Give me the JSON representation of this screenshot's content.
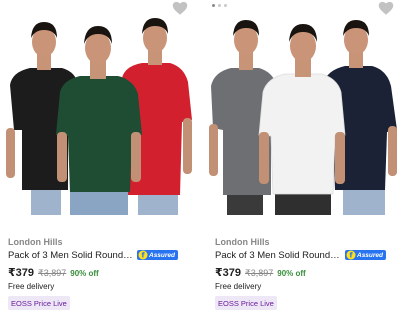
{
  "products": [
    {
      "brand": "London Hills",
      "title": "Pack of 3 Men Solid Round Neck ...",
      "assured_label": "Assured",
      "price": "₹379",
      "mrp": "₹3,897",
      "discount": "90% off",
      "delivery": "Free delivery",
      "tag": "EOSS Price Live",
      "shirt_colors": [
        "#1c1c1c",
        "#1f4d33",
        "#d2202f"
      ]
    },
    {
      "brand": "London Hills",
      "title": "Pack of 3 Men Solid Round Neck ...",
      "assured_label": "Assured",
      "price": "₹379",
      "mrp": "₹3,897",
      "discount": "90% off",
      "delivery": "Free delivery",
      "tag": "EOSS Price Live",
      "shirt_colors": [
        "#6e6f73",
        "#f2f2f2",
        "#1b2236"
      ]
    }
  ],
  "carousel": {
    "total": 3,
    "active": 1
  },
  "colors": {
    "assured_blue": "#2874f0",
    "discount_green": "#388e3c",
    "tag_bg": "#ede7f6",
    "tag_text": "#6a1b9a"
  },
  "icons": {
    "wishlist": "heart-icon",
    "assured": "flipkart-assured-icon"
  }
}
